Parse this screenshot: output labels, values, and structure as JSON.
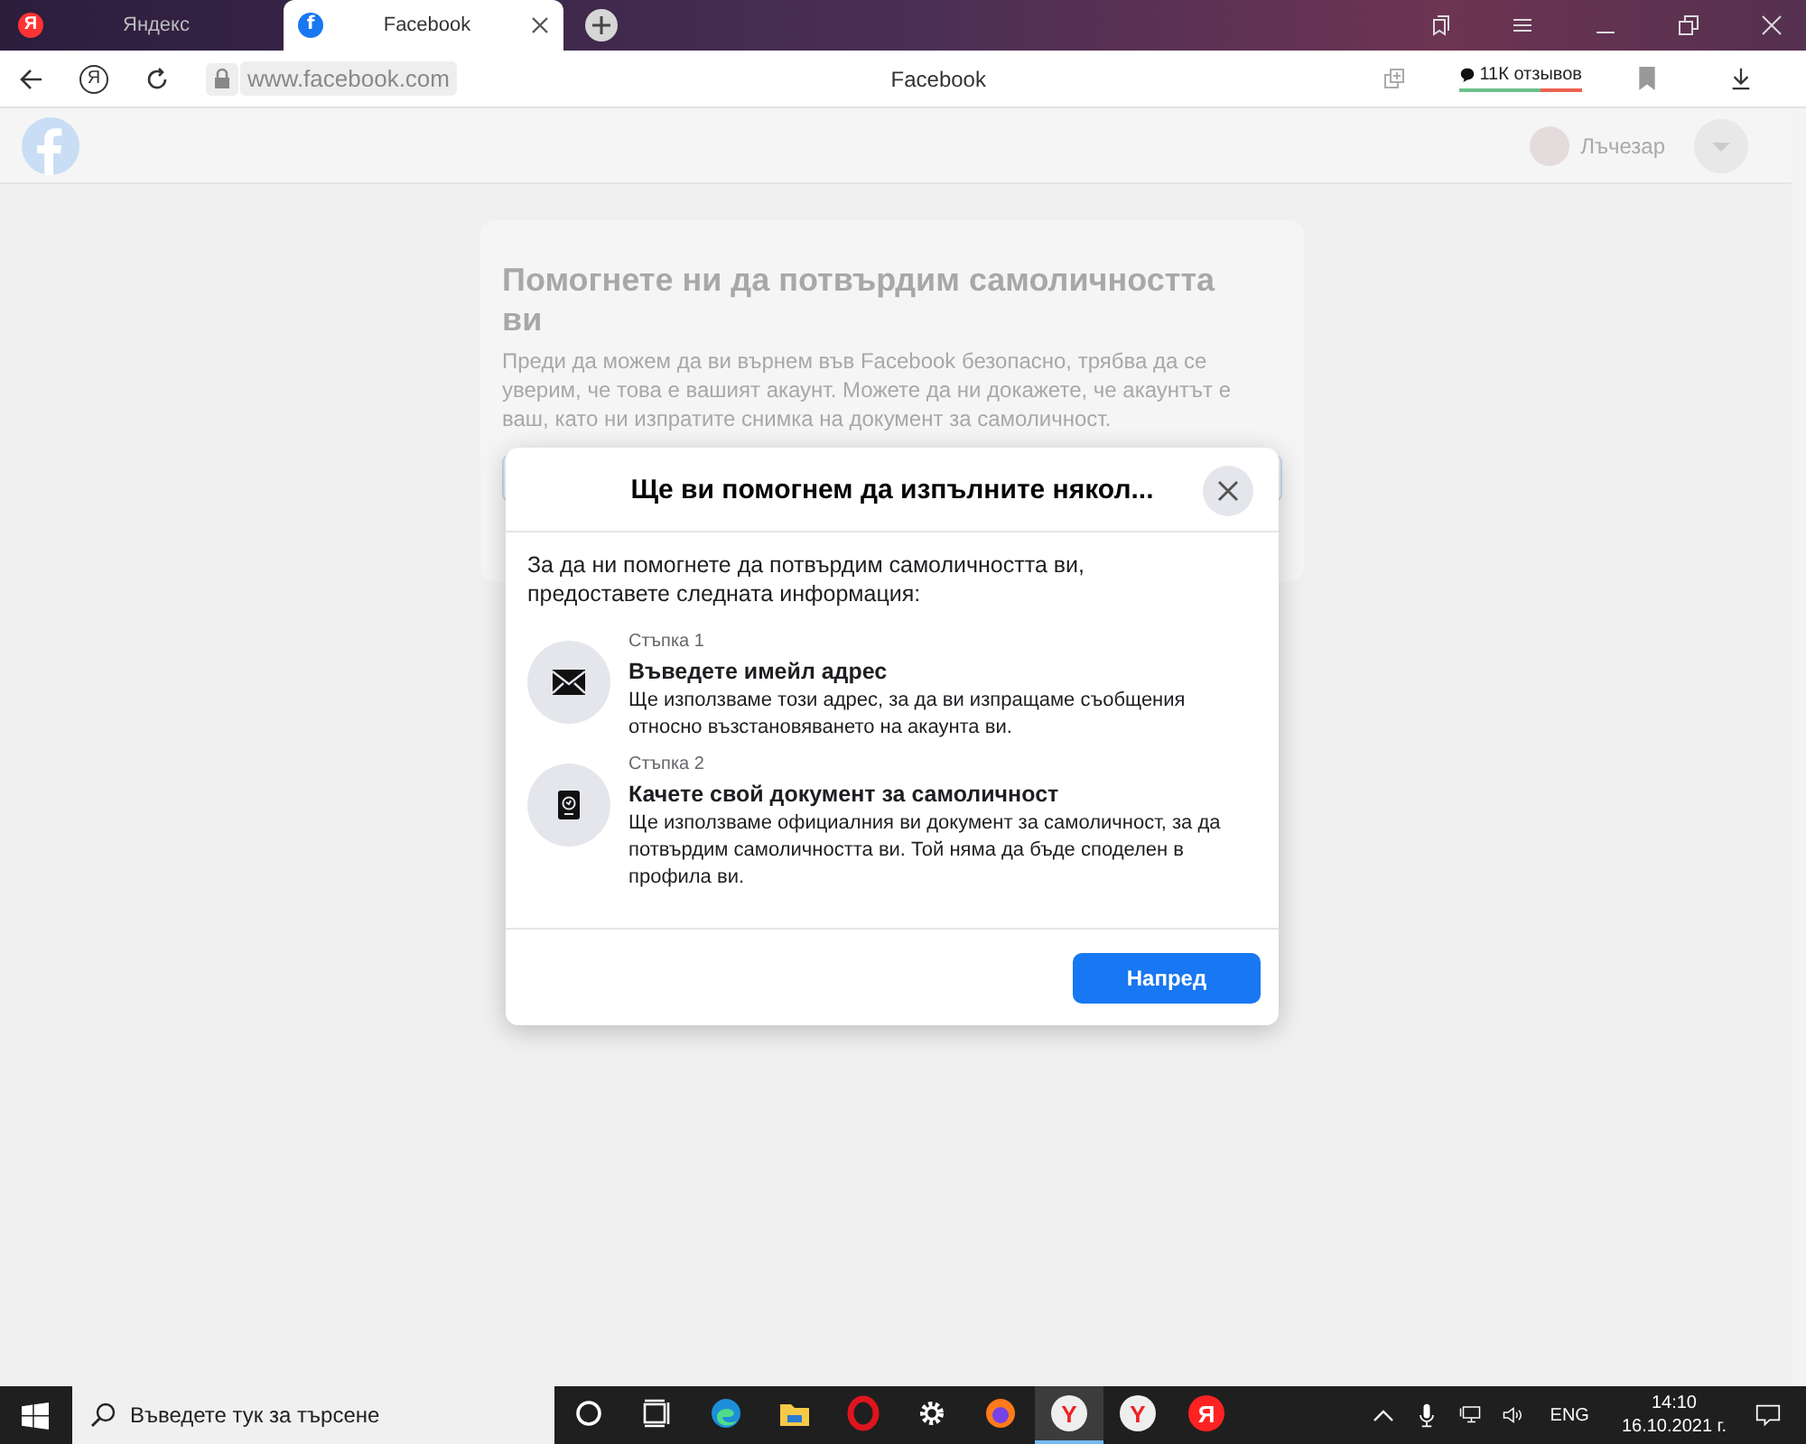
{
  "browser": {
    "tabs": [
      {
        "label": "Яндекс",
        "selected": false,
        "kind": "yandex",
        "logo": "Я"
      },
      {
        "label": "Facebook",
        "selected": true,
        "kind": "facebook",
        "logo": "f"
      }
    ],
    "toolbar": {
      "yandex_button": "Я",
      "url": "www.facebook.com",
      "page_title": "Facebook",
      "reviews": {
        "label": "11К отзывов",
        "level": 0.66
      }
    }
  },
  "page": {
    "header": {
      "user_name": "Лъчезар"
    },
    "card": {
      "title": "Помогнете ни да потвърдим самоличността ви",
      "text": "Преди да можем да ви върнем във Facebook безопасно, трябва да се уверим, че това е вашият акаунт. Можете да ни докажете, че акаунтът е ваш, като ни изпратите снимка на документ за самоличност."
    },
    "dialog": {
      "title": "Ще ви помогнем да изпълните някол...",
      "intro": "За да ни помогнете да потвърдим самоличността ви, предоставете следната информация:",
      "steps": [
        {
          "kind": "email",
          "label": "Стъпка 1",
          "title": "Въведете имейл адрес",
          "text": "Ще използваме този адрес, за да ви изпращаме съобщения относно възстановяването на акаунта ви."
        },
        {
          "kind": "id",
          "label": "Стъпка 2",
          "title": "Качете свой документ за самоличност",
          "text": "Ще използваме официалния ви документ за самоличност, за да потвърдим самоличността ви. Той няма да бъде споделен в профила ви."
        }
      ],
      "button": "Напред"
    }
  },
  "taskbar": {
    "search_placeholder": "Въведете тук за търсене",
    "apps": [
      {
        "kind": "cortana",
        "active": false
      },
      {
        "kind": "taskview",
        "active": false
      },
      {
        "kind": "edge",
        "active": false
      },
      {
        "kind": "explorer",
        "active": false
      },
      {
        "kind": "opera",
        "active": false
      },
      {
        "kind": "settings",
        "active": false
      },
      {
        "kind": "firefox",
        "active": false
      },
      {
        "kind": "ybrowser",
        "active": true,
        "logo": "Y"
      },
      {
        "kind": "ybrowser",
        "active": false,
        "logo": "Y"
      },
      {
        "kind": "yandex",
        "active": false,
        "logo": "Я"
      }
    ],
    "language": "ENG",
    "time": "14:10",
    "date": "16.10.2021 г."
  }
}
